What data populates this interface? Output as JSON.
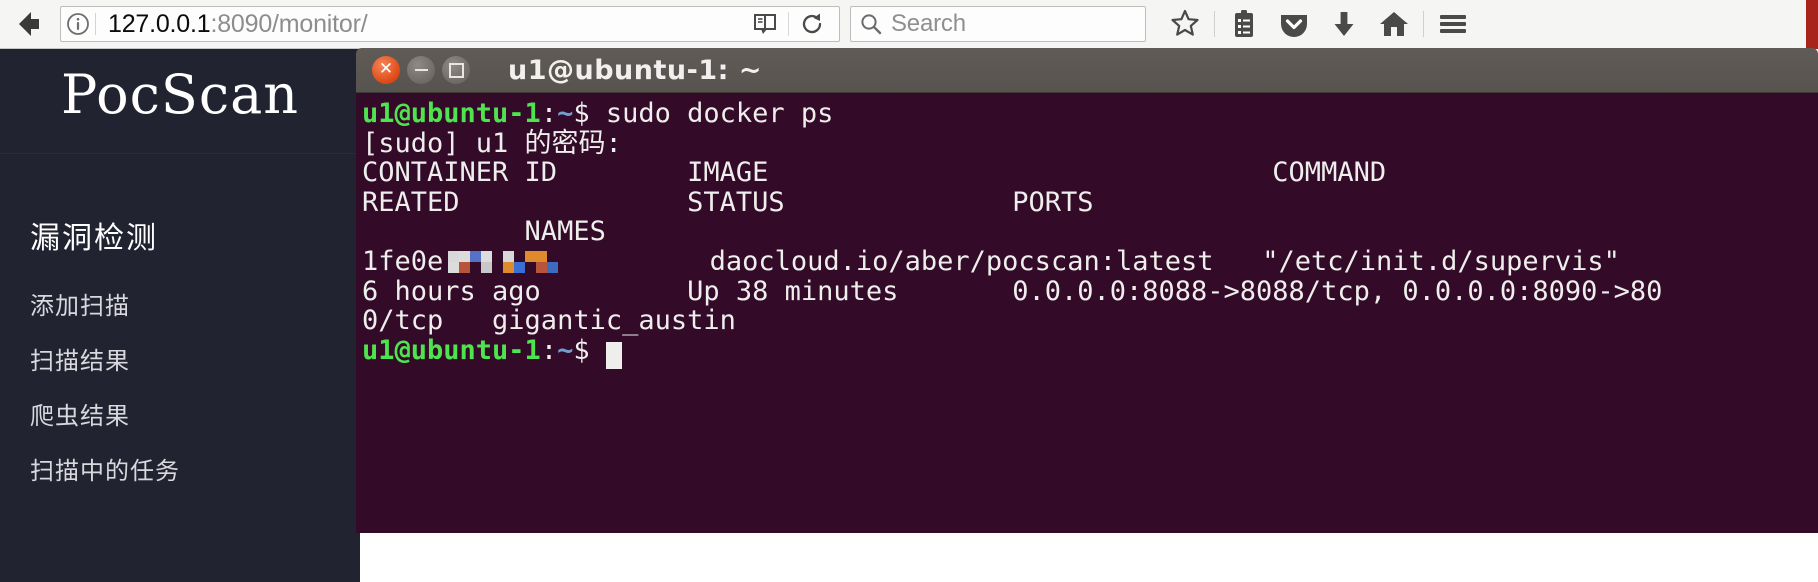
{
  "browser": {
    "back_label": "Back",
    "identity_icon": "info-circle-icon",
    "url_host": "127.0.0.1",
    "url_rest": ":8090/monitor/",
    "url_full": "127.0.0.1:8090/monitor/",
    "reader_icon": "reader-mode-icon",
    "reload_icon": "reload-icon",
    "search_placeholder": "Search",
    "search_value": "",
    "search_icon": "search-icon",
    "toolbar_icons": [
      {
        "name": "bookmark-star-icon",
        "label": "Bookmark this page"
      },
      {
        "name": "library-icon",
        "label": "Show your library"
      },
      {
        "name": "pocket-icon",
        "label": "Save to Pocket"
      },
      {
        "name": "downloads-icon",
        "label": "Downloads"
      },
      {
        "name": "home-icon",
        "label": "Home"
      },
      {
        "name": "menu-hamburger-icon",
        "label": "Open menu"
      }
    ],
    "edge_accent_color": "#a8251b"
  },
  "sidebar": {
    "brand": "PocScan",
    "background_color": "#222331",
    "section_title": "漏洞检测",
    "items": [
      {
        "label": "添加扫描"
      },
      {
        "label": "扫描结果"
      },
      {
        "label": "爬虫结果"
      },
      {
        "label": "扫描中的任务"
      }
    ]
  },
  "terminal": {
    "title": "u1@ubuntu-1: ~",
    "background_color": "#330a28",
    "foreground_color": "#eeeeec",
    "window_buttons": [
      {
        "name": "close-button",
        "glyph": "✕"
      },
      {
        "name": "minimize-button",
        "glyph": ""
      },
      {
        "name": "maximize-button",
        "glyph": ""
      }
    ],
    "prompt": {
      "user_host": "u1@ubuntu-1",
      "colon": ":",
      "path": "~",
      "sigil": "$"
    },
    "lines": [
      {
        "type": "prompt",
        "command": " sudo docker ps"
      },
      {
        "type": "text",
        "text": "[sudo] u1 的密码:"
      },
      {
        "type": "text",
        "text": "CONTAINER ID        IMAGE                               COMMAND"
      },
      {
        "type": "text",
        "text": "REATED              STATUS              PORTS"
      },
      {
        "type": "text",
        "text": "          NAMES"
      },
      {
        "type": "censored",
        "prefix": "1fe0e",
        "suffix": "         daocloud.io/aber/pocscan:latest   \"/etc/init.d/supervis\""
      },
      {
        "type": "text",
        "text": "6 hours ago         Up 38 minutes       0.0.0.0:8088->8088/tcp, 0.0.0.0:8090->80"
      },
      {
        "type": "text",
        "text": "0/tcp   gigantic_austin"
      },
      {
        "type": "prompt",
        "command": " ",
        "cursor": true
      }
    ],
    "censored_colors": [
      "#e08a2e",
      "#3b6fd4",
      "#d8d8d8",
      "#2f4f9e",
      "#c8c8c8",
      "#5572c8",
      "#e0e0e0",
      "#b8543a",
      "#3c6bbf",
      "#dcdcdc"
    ]
  }
}
